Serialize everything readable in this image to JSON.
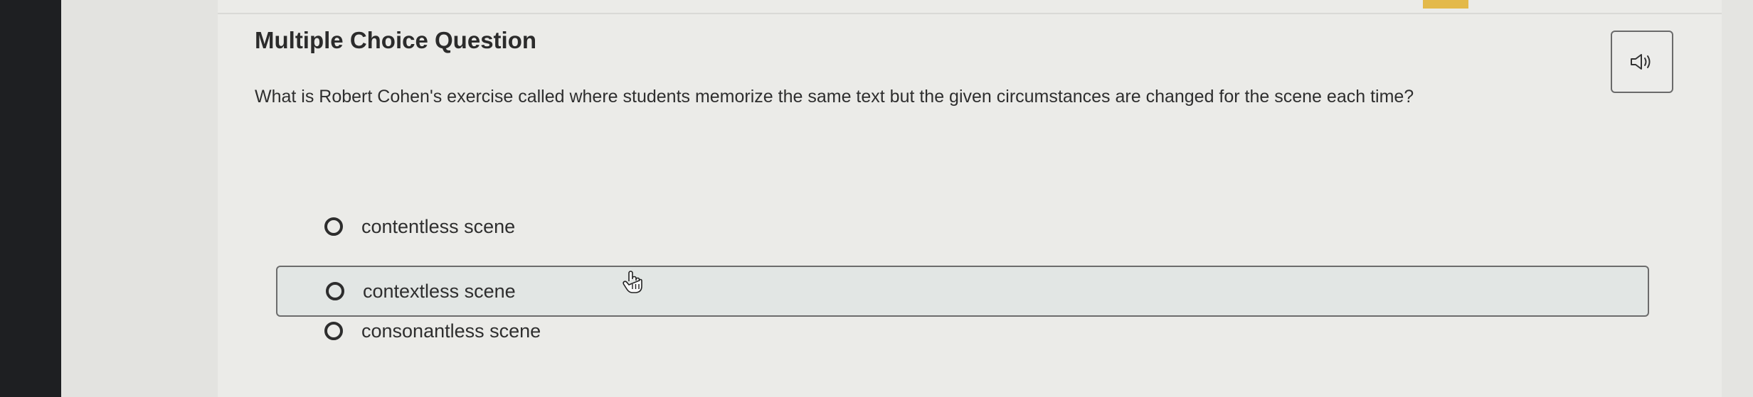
{
  "question": {
    "type_label": "Multiple Choice Question",
    "prompt": "What is Robert Cohen's exercise called where students memorize the same text but the given circumstances are changed for the scene each time?"
  },
  "audio": {
    "icon": "speaker-icon"
  },
  "choices": [
    {
      "label": "contentless scene",
      "selected": false,
      "highlighted": false
    },
    {
      "label": "contextless scene",
      "selected": false,
      "highlighted": true
    },
    {
      "label": "consonantless scene",
      "selected": false,
      "highlighted": false
    }
  ],
  "cursor": {
    "icon": "hand-pointer-icon"
  },
  "colors": {
    "background": "#ebebe8",
    "text": "#2e2e2e",
    "highlight_border": "#6c6c6c",
    "highlight_fill": "#e2e6e4",
    "accent_tab": "#e3b94a",
    "bezel": "#1e1f22"
  }
}
